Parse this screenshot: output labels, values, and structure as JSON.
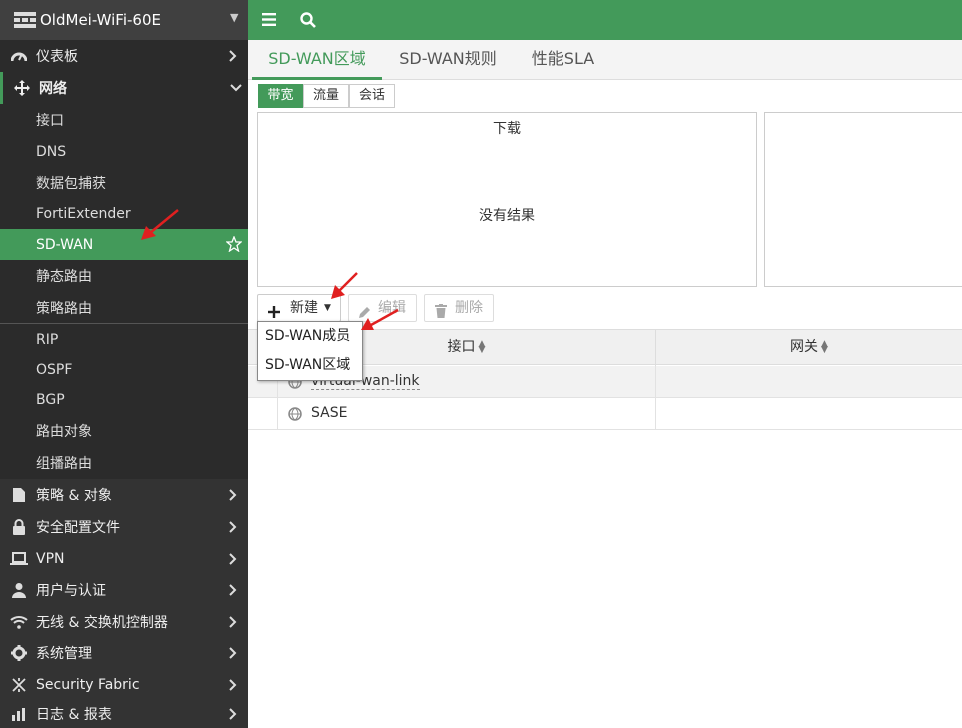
{
  "brand": {
    "name": "OldMei-WiFi-60E"
  },
  "sidebar": {
    "items": [
      {
        "label": "仪表板",
        "icon": "dashboard-icon"
      },
      {
        "label": "网络",
        "icon": "network-icon"
      },
      {
        "label": "策略 & 对象",
        "icon": "policy-icon"
      },
      {
        "label": "安全配置文件",
        "icon": "lock-icon"
      },
      {
        "label": "VPN",
        "icon": "laptop-icon"
      },
      {
        "label": "用户与认证",
        "icon": "user-icon"
      },
      {
        "label": "无线 & 交换机控制器",
        "icon": "wifi-icon"
      },
      {
        "label": "系统管理",
        "icon": "gear-icon"
      },
      {
        "label": "Security Fabric",
        "icon": "fabric-icon"
      },
      {
        "label": "日志 & 报表",
        "icon": "chart-icon"
      }
    ],
    "network_sub": [
      "接口",
      "DNS",
      "数据包捕获",
      "FortiExtender",
      "SD-WAN",
      "静态路由",
      "策略路由",
      "RIP",
      "OSPF",
      "BGP",
      "路由对象",
      "组播路由"
    ]
  },
  "tabs": [
    "SD-WAN区域",
    "SD-WAN规则",
    "性能SLA"
  ],
  "segments": [
    "带宽",
    "流量",
    "会话"
  ],
  "panel": {
    "title": "下载",
    "empty": "没有结果"
  },
  "toolbar": {
    "new": "新建",
    "edit": "编辑",
    "delete": "删除"
  },
  "dropdown": [
    "SD-WAN成员",
    "SD-WAN区域"
  ],
  "table": {
    "headers": [
      "接口",
      "网关"
    ],
    "rows": [
      {
        "name": "virtual-wan-link"
      },
      {
        "name": "SASE"
      }
    ]
  },
  "colors": {
    "accent": "#439a5a",
    "sidebar": "#2b2b2b",
    "arrow": "#e02020"
  }
}
